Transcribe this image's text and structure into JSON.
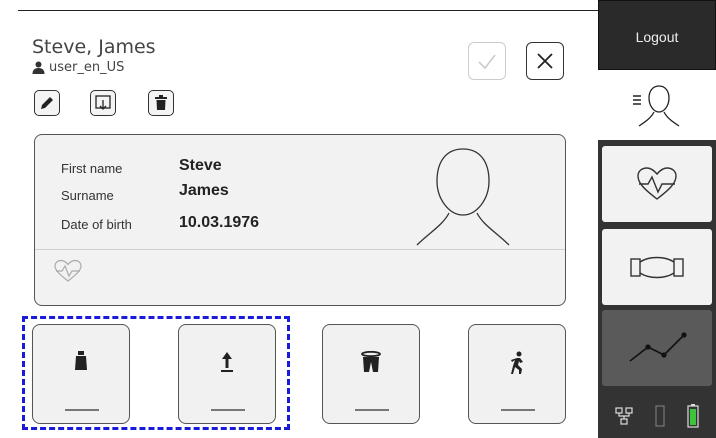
{
  "patient": {
    "display_name": "Steve, James",
    "user_id": "user_en_US"
  },
  "details": {
    "first_name_label": "First name",
    "first_name": "Steve",
    "surname_label": "Surname",
    "surname": "James",
    "dob_label": "Date of birth",
    "dob": "10.03.1976"
  },
  "sidebar": {
    "logout_label": "Logout"
  },
  "measurements": [
    {
      "name": "weight",
      "value": "—"
    },
    {
      "name": "height",
      "value": "—"
    },
    {
      "name": "waist",
      "value": "—"
    },
    {
      "name": "activity",
      "value": "—"
    }
  ],
  "colors": {
    "highlight": "#1a1adc",
    "battery": "#3cc43c",
    "sidebar": "#333333"
  }
}
